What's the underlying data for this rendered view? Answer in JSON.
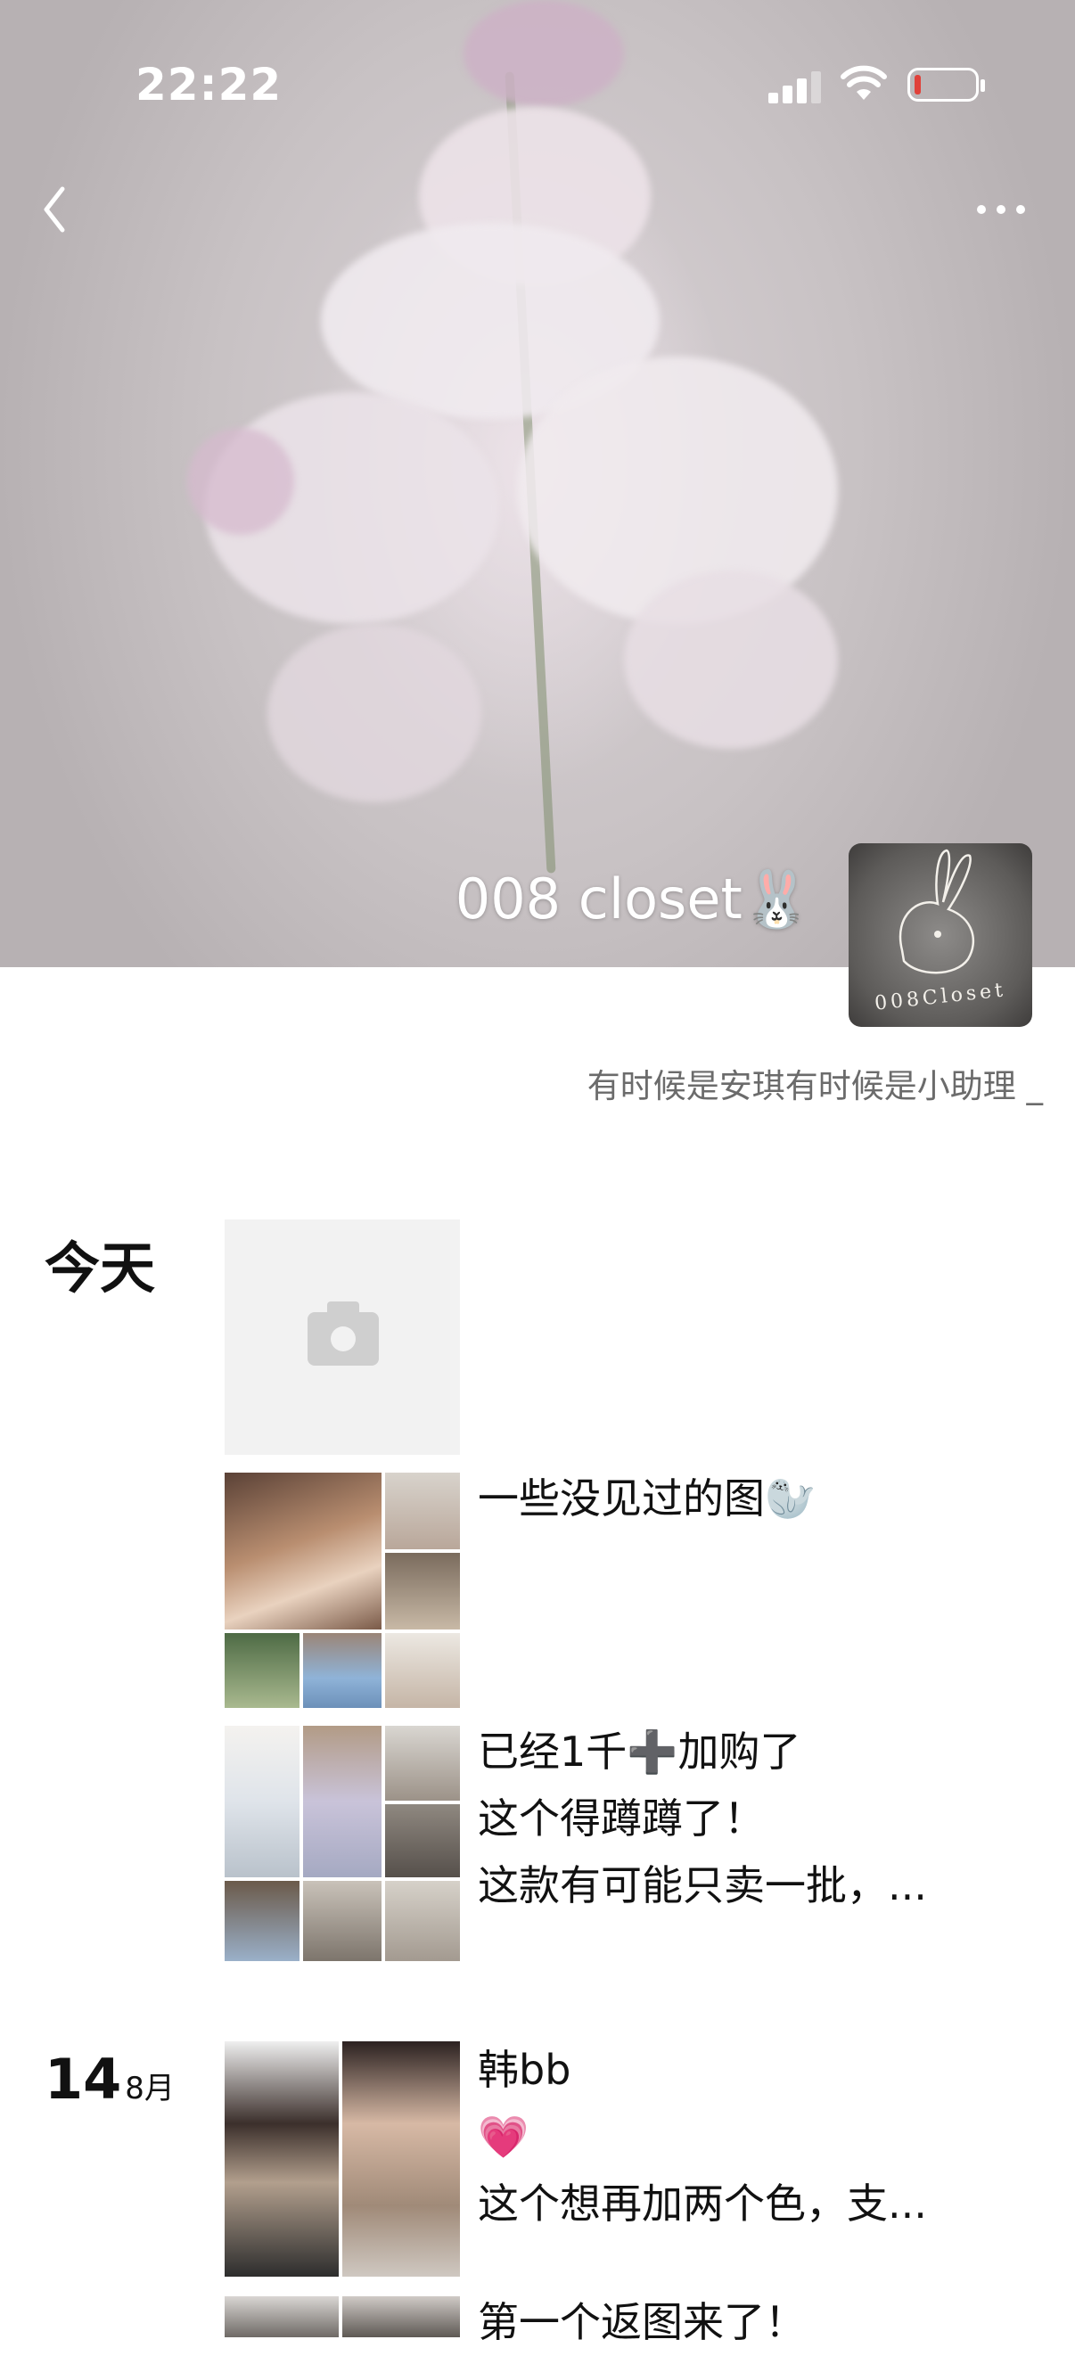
{
  "status_bar": {
    "time": "22:22",
    "battery_color": "#e0413a"
  },
  "header": {
    "back_icon": "chevron-left-icon",
    "more_icon": "more-dots-icon",
    "username": "008 closet🐰",
    "avatar_text": "008Closet",
    "signature": "有时候是安琪有时候是小助理 _"
  },
  "feed": [
    {
      "date_label": "今天",
      "posts": [
        {
          "type": "camera",
          "icon": "camera-icon",
          "text": ""
        },
        {
          "type": "images",
          "text": "一些没见过的图🦭"
        },
        {
          "type": "images",
          "text": "已经1千➕加购了\n这个得蹲蹲了！\n这款有可能只卖一批，..."
        }
      ]
    },
    {
      "day": "14",
      "month": "8月",
      "posts": [
        {
          "type": "images",
          "text": "韩bb\n💗\n这个想再加两个色，支..."
        },
        {
          "type": "images",
          "text": "第一个返图来了！"
        }
      ]
    }
  ]
}
